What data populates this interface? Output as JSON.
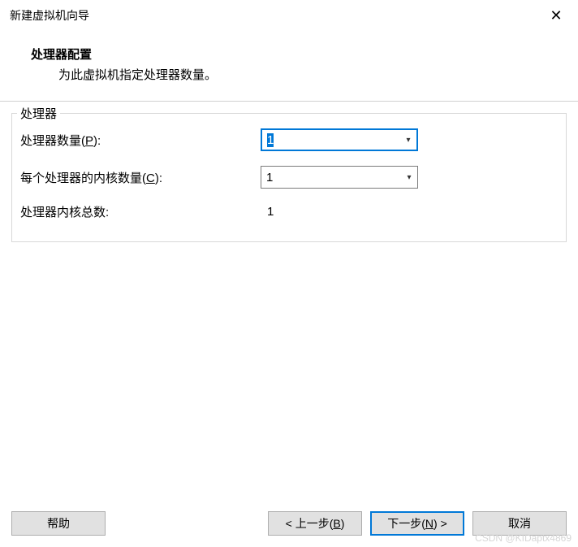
{
  "window": {
    "title": "新建虚拟机向导"
  },
  "header": {
    "title": "处理器配置",
    "subtitle": "为此虚拟机指定处理器数量。"
  },
  "group": {
    "legend": "处理器",
    "rows": {
      "processors": {
        "label_pre": "处理器数量(",
        "hotkey": "P",
        "label_post": "):",
        "value": "1"
      },
      "cores": {
        "label_pre": "每个处理器的内核数量(",
        "hotkey": "C",
        "label_post": "):",
        "value": "1"
      },
      "total": {
        "label": "处理器内核总数:",
        "value": "1"
      }
    }
  },
  "buttons": {
    "help": "帮助",
    "back_pre": "< 上一步(",
    "back_hotkey": "B",
    "back_post": ")",
    "next_pre": "下一步(",
    "next_hotkey": "N",
    "next_post": ") >",
    "cancel": "取消"
  },
  "watermark": "CSDN @KIDaptx4869"
}
